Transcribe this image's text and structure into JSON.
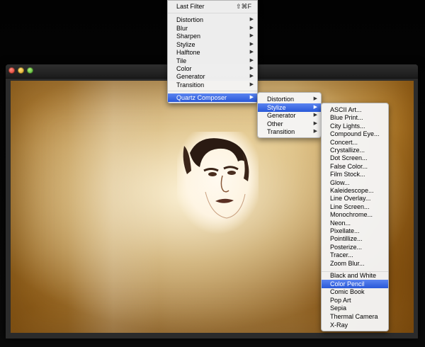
{
  "main_menu": {
    "last_filter": {
      "label": "Last Filter",
      "shortcut": "⇧⌘F"
    },
    "items": [
      {
        "label": "Distortion",
        "submenu": true
      },
      {
        "label": "Blur",
        "submenu": true
      },
      {
        "label": "Sharpen",
        "submenu": true
      },
      {
        "label": "Stylize",
        "submenu": true
      },
      {
        "label": "Halftone",
        "submenu": true
      },
      {
        "label": "Tile",
        "submenu": true
      },
      {
        "label": "Color",
        "submenu": true
      },
      {
        "label": "Generator",
        "submenu": true
      },
      {
        "label": "Transition",
        "submenu": true
      }
    ],
    "quartz": {
      "label": "Quartz Composer",
      "selected": true
    }
  },
  "sub_menu_1": {
    "items": [
      {
        "label": "Distortion",
        "selected": false
      },
      {
        "label": "Stylize",
        "selected": true
      },
      {
        "label": "Generator",
        "selected": false
      },
      {
        "label": "Other",
        "selected": false
      },
      {
        "label": "Transition",
        "selected": false
      }
    ]
  },
  "sub_menu_2": {
    "group1": [
      "ASCII Art...",
      "Blue Print...",
      "City Lights...",
      "Compound Eye...",
      "Concert...",
      "Crystallize...",
      "Dot Screen...",
      "False Color...",
      "Film Stock...",
      "Glow...",
      "Kaleidescope...",
      "Line Overlay...",
      "Line Screen...",
      "Monochrome...",
      "Neon...",
      "Pixellate...",
      "Pointillize...",
      "Posterize...",
      "Tracer...",
      "Zoom Blur..."
    ],
    "group2": [
      "Black and White",
      "Color Pencil",
      "Comic Book",
      "Pop Art",
      "Sepia",
      "Thermal Camera",
      "X-Ray"
    ],
    "selected": "Color Pencil"
  },
  "icons": {
    "submenu_arrow": "triangle-right-icon"
  },
  "colors": {
    "selection": "#2958d8",
    "menu_bg": "#f5f5f5"
  }
}
